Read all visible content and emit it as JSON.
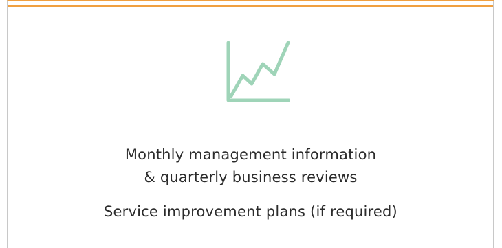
{
  "accent_color": "#f0a040",
  "icon": {
    "name": "line-chart-icon",
    "color": "#9fd4b8"
  },
  "card": {
    "line1": "Monthly management information",
    "line2": "& quarterly business reviews",
    "line3": "Service improvement plans (if required)"
  }
}
